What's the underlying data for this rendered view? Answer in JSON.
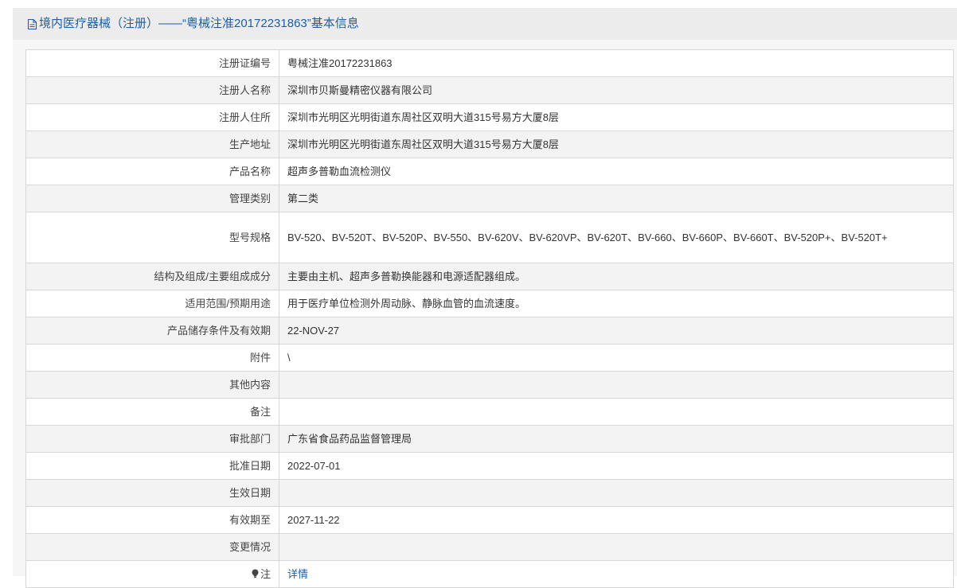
{
  "header": {
    "title": "境内医疗器械（注册）——“粤械注准20172231863”基本信息",
    "icon": "document-icon"
  },
  "colors": {
    "link": "#1b5fa8",
    "border": "#d7d7d7",
    "header_bg": "#ececec",
    "alt_row_bg": "#f3f3f3"
  },
  "rows": [
    {
      "label": "注册证编号",
      "value": "粤械注准20172231863"
    },
    {
      "label": "注册人名称",
      "value": "深圳市贝斯曼精密仪器有限公司"
    },
    {
      "label": "注册人住所",
      "value": "深圳市光明区光明街道东周社区双明大道315号易方大厦8层"
    },
    {
      "label": "生产地址",
      "value": "深圳市光明区光明街道东周社区双明大道315号易方大厦8层"
    },
    {
      "label": "产品名称",
      "value": "超声多普勒血流检测仪"
    },
    {
      "label": "管理类别",
      "value": "第二类"
    },
    {
      "label": "型号规格",
      "value": "BV-520、BV-520T、BV-520P、BV-550、BV-620V、BV-620VP、BV-620T、BV-660、BV-660P、BV-660T、BV-520P+、BV-520T+"
    },
    {
      "label": "结构及组成/主要组成成分",
      "value": "主要由主机、超声多普勒换能器和电源适配器组成。"
    },
    {
      "label": "适用范围/预期用途",
      "value": "用于医疗单位检测外周动脉、静脉血管的血流速度。"
    },
    {
      "label": "产品储存条件及有效期",
      "value": "22-NOV-27"
    },
    {
      "label": "附件",
      "value": "\\"
    },
    {
      "label": "其他内容",
      "value": ""
    },
    {
      "label": "备注",
      "value": ""
    },
    {
      "label": "审批部门",
      "value": "广东省食品药品监督管理局"
    },
    {
      "label": "批准日期",
      "value": "2022-07-01"
    },
    {
      "label": "生效日期",
      "value": ""
    },
    {
      "label": "有效期至",
      "value": "2027-11-22"
    },
    {
      "label": "变更情况",
      "value": ""
    }
  ],
  "note_row": {
    "label": "注",
    "icon": "lightbulb-icon",
    "link_text": "详情"
  }
}
